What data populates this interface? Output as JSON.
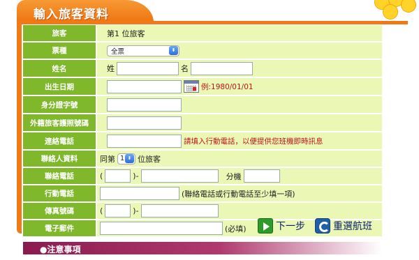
{
  "header": {
    "title": "輸入旅客資料"
  },
  "form": {
    "rows": [
      {
        "label": "旅客",
        "value": "第1 位旅客"
      },
      {
        "label": "票種",
        "select": "全票"
      },
      {
        "label": "姓名",
        "surname_prefix": "姓",
        "given_prefix": "名"
      },
      {
        "label": "出生日期",
        "example": "例:1980/01/01"
      },
      {
        "label": "身分證字號"
      },
      {
        "label": "外籍旅客護照號碼"
      },
      {
        "label": "連絡電話",
        "hint": "請填入行動電話，以便提供您班機即時訊息"
      },
      {
        "label": "聯絡人資料",
        "prefix": "同第",
        "select": "1",
        "suffix": "位旅客"
      },
      {
        "label": "聯絡電話",
        "open_paren": "(",
        "close_paren": ")-",
        "ext_label": "分機"
      },
      {
        "label": "行動電話",
        "note": "(聯絡電話或行動電話至少填一項)"
      },
      {
        "label": "傳真號碼",
        "open_paren": "(",
        "close_paren": ")-"
      },
      {
        "label": "電子郵件",
        "note": "(必填)"
      }
    ]
  },
  "buttons": {
    "next": "下一步",
    "reselect": "重選航班"
  },
  "notice": {
    "title": "●注意事項"
  }
}
